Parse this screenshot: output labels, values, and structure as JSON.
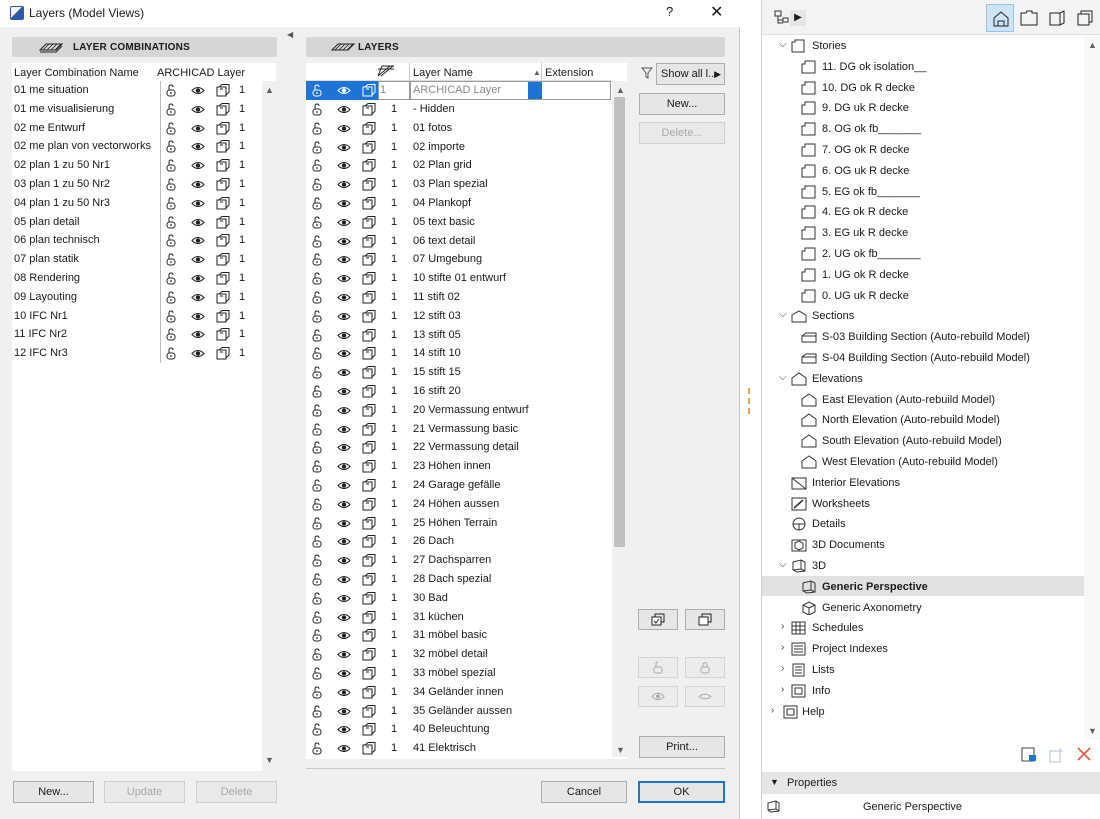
{
  "window": {
    "title": "Layers (Model Views)",
    "help_glyph": "?",
    "close_glyph": "✕"
  },
  "layer_combinations": {
    "header": "LAYER COMBINATIONS",
    "col_name": "Layer Combination Name",
    "col_layer": "ARCHICAD Layer",
    "rows": [
      {
        "name": "01 me situation",
        "num": "1"
      },
      {
        "name": "01 me visualisierung",
        "num": "1"
      },
      {
        "name": "02 me Entwurf",
        "num": "1"
      },
      {
        "name": "02 me plan von vectorworks",
        "num": "1"
      },
      {
        "name": "02 plan 1 zu 50 Nr1",
        "num": "1"
      },
      {
        "name": "03 plan 1 zu 50 Nr2",
        "num": "1"
      },
      {
        "name": "04 plan 1 zu 50 Nr3",
        "num": "1"
      },
      {
        "name": "05 plan detail",
        "num": "1"
      },
      {
        "name": "06 plan technisch",
        "num": "1"
      },
      {
        "name": "07 plan statik",
        "num": "1"
      },
      {
        "name": "08 Rendering",
        "num": "1"
      },
      {
        "name": "09 Layouting",
        "num": "1"
      },
      {
        "name": "10 IFC Nr1",
        "num": "1"
      },
      {
        "name": "11 IFC Nr2",
        "num": "1"
      },
      {
        "name": "12 IFC Nr3",
        "num": "1"
      }
    ],
    "buttons": {
      "new": "New...",
      "update": "Update",
      "delete": "Delete"
    }
  },
  "layers": {
    "header": "LAYERS",
    "col_name": "Layer Name",
    "col_extension": "Extension",
    "selected_row": {
      "name": "ARCHICAD Layer",
      "num": "1"
    },
    "rows": [
      {
        "name": "- Hidden",
        "num": "1"
      },
      {
        "name": "01 fotos",
        "num": "1"
      },
      {
        "name": "02 importe",
        "num": "1"
      },
      {
        "name": "02 Plan grid",
        "num": "1"
      },
      {
        "name": "03 Plan spezial",
        "num": "1"
      },
      {
        "name": "04 Plankopf",
        "num": "1"
      },
      {
        "name": "05 text basic",
        "num": "1"
      },
      {
        "name": "06 text detail",
        "num": "1"
      },
      {
        "name": "07 Umgebung",
        "num": "1"
      },
      {
        "name": "10 stifte 01 entwurf",
        "num": "1"
      },
      {
        "name": "11 stift 02",
        "num": "1"
      },
      {
        "name": "12 stift 03",
        "num": "1"
      },
      {
        "name": "13 stift 05",
        "num": "1"
      },
      {
        "name": "14 stift 10",
        "num": "1"
      },
      {
        "name": "15 stift 15",
        "num": "1"
      },
      {
        "name": "16 stift 20",
        "num": "1"
      },
      {
        "name": "20 Vermassung entwurf",
        "num": "1"
      },
      {
        "name": "21 Vermassung basic",
        "num": "1"
      },
      {
        "name": "22 Vermassung detail",
        "num": "1"
      },
      {
        "name": "23 Höhen innen",
        "num": "1"
      },
      {
        "name": "24 Garage gefälle",
        "num": "1"
      },
      {
        "name": "24 Höhen aussen",
        "num": "1"
      },
      {
        "name": "25 Höhen Terrain",
        "num": "1"
      },
      {
        "name": "26 Dach",
        "num": "1"
      },
      {
        "name": "27 Dachsparren",
        "num": "1"
      },
      {
        "name": "28 Dach spezial",
        "num": "1"
      },
      {
        "name": "30 Bad",
        "num": "1"
      },
      {
        "name": "31 küchen",
        "num": "1"
      },
      {
        "name": "31 möbel basic",
        "num": "1"
      },
      {
        "name": "32 möbel detail",
        "num": "1"
      },
      {
        "name": "33 möbel spezial",
        "num": "1"
      },
      {
        "name": "34 Geländer innen",
        "num": "1"
      },
      {
        "name": "35 Geländer aussen",
        "num": "1"
      },
      {
        "name": "40 Beleuchtung",
        "num": "1"
      },
      {
        "name": "41 Elektrisch",
        "num": "1"
      }
    ]
  },
  "side_buttons": {
    "show_all": "Show all l...",
    "new": "New...",
    "delete": "Delete...",
    "print": "Print...",
    "cancel": "Cancel",
    "ok": "OK"
  },
  "navigator": {
    "items": [
      {
        "label": "Stories",
        "level": 1,
        "chev": "expanded",
        "icon": "stories-icon"
      },
      {
        "label": "11. DG ok isolation__",
        "level": 2,
        "icon": "story-icon"
      },
      {
        "label": "10. DG ok R decke",
        "level": 2,
        "icon": "story-icon"
      },
      {
        "label": "9. DG uk R decke",
        "level": 2,
        "icon": "story-icon"
      },
      {
        "label": "8. OG ok fb_______",
        "level": 2,
        "icon": "story-icon"
      },
      {
        "label": "7. OG ok R decke",
        "level": 2,
        "icon": "story-icon"
      },
      {
        "label": "6. OG uk R decke",
        "level": 2,
        "icon": "story-icon"
      },
      {
        "label": "5. EG ok fb_______",
        "level": 2,
        "icon": "story-icon"
      },
      {
        "label": "4. EG ok R decke",
        "level": 2,
        "icon": "story-icon"
      },
      {
        "label": "3. EG uk R decke",
        "level": 2,
        "icon": "story-icon"
      },
      {
        "label": "2. UG ok fb_______",
        "level": 2,
        "icon": "story-icon"
      },
      {
        "label": "1. UG ok R decke",
        "level": 2,
        "icon": "story-icon"
      },
      {
        "label": "0. UG uk R decke",
        "level": 2,
        "icon": "story-icon"
      },
      {
        "label": "Sections",
        "level": 1,
        "chev": "expanded",
        "icon": "sections-icon"
      },
      {
        "label": "S-03 Building Section (Auto-rebuild Model)",
        "level": 2,
        "icon": "section-icon"
      },
      {
        "label": "S-04 Building Section (Auto-rebuild Model)",
        "level": 2,
        "icon": "section-icon"
      },
      {
        "label": "Elevations",
        "level": 1,
        "chev": "expanded",
        "icon": "elevations-icon"
      },
      {
        "label": "East Elevation (Auto-rebuild Model)",
        "level": 2,
        "icon": "elevation-icon"
      },
      {
        "label": "North Elevation (Auto-rebuild Model)",
        "level": 2,
        "icon": "elevation-icon"
      },
      {
        "label": "South Elevation (Auto-rebuild Model)",
        "level": 2,
        "icon": "elevation-icon"
      },
      {
        "label": "West Elevation (Auto-rebuild Model)",
        "level": 2,
        "icon": "elevation-icon"
      },
      {
        "label": "Interior Elevations",
        "level": 1,
        "chev": "none",
        "icon": "interior-elevations-icon"
      },
      {
        "label": "Worksheets",
        "level": 1,
        "chev": "none",
        "icon": "worksheets-icon"
      },
      {
        "label": "Details",
        "level": 1,
        "chev": "none",
        "icon": "details-icon"
      },
      {
        "label": "3D Documents",
        "level": 1,
        "chev": "none",
        "icon": "3d-documents-icon"
      },
      {
        "label": "3D",
        "level": 1,
        "chev": "expanded",
        "icon": "3d-icon"
      },
      {
        "label": "Generic Perspective",
        "level": 2,
        "icon": "perspective-icon",
        "selected": true
      },
      {
        "label": "Generic Axonometry",
        "level": 2,
        "icon": "axonometry-icon"
      },
      {
        "label": "Schedules",
        "level": 1,
        "chev": "collapsed",
        "icon": "schedules-icon"
      },
      {
        "label": "Project Indexes",
        "level": 1,
        "chev": "collapsed",
        "icon": "project-indexes-icon"
      },
      {
        "label": "Lists",
        "level": 1,
        "chev": "collapsed",
        "icon": "lists-icon"
      },
      {
        "label": "Info",
        "level": 1,
        "chev": "collapsed",
        "icon": "info-icon"
      },
      {
        "label": "Help",
        "level": 0,
        "chev": "collapsed",
        "icon": "help-icon"
      }
    ],
    "properties_header": "Properties",
    "properties_value": "Generic Perspective"
  },
  "colors": {
    "accent": "#1e74d4",
    "danger": "#e05a3a"
  }
}
